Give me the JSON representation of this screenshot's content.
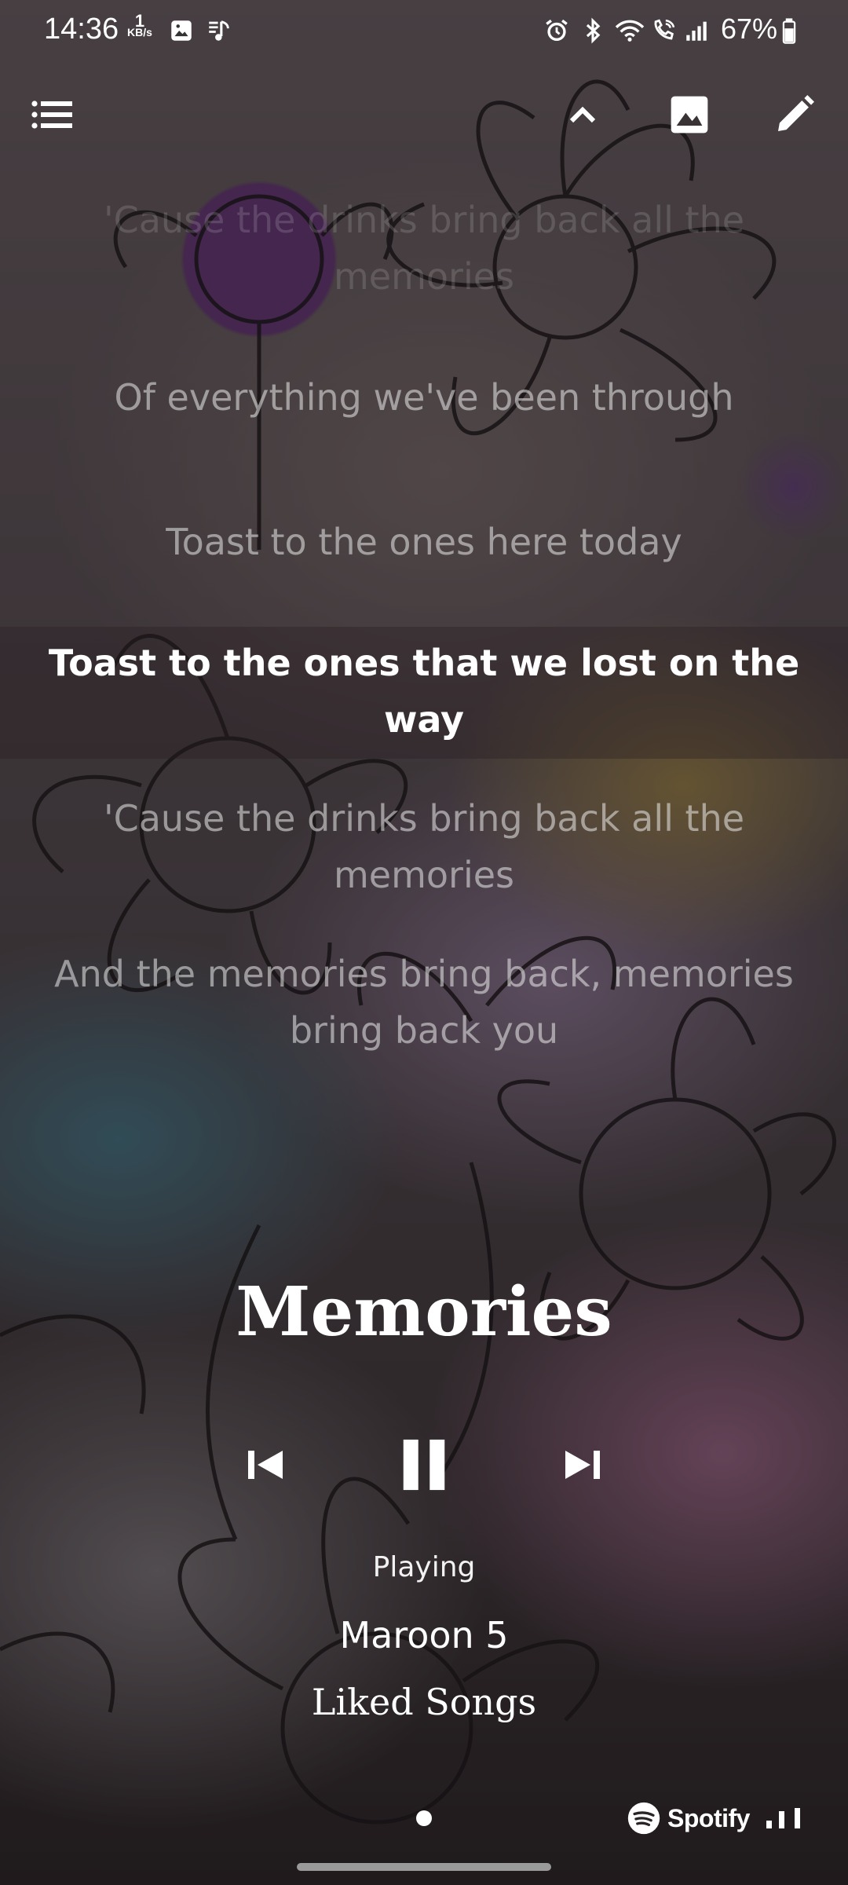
{
  "status_bar": {
    "time": "14:36",
    "net_speed_value": "1",
    "net_speed_unit": "KB/s",
    "battery": "67%",
    "icons": [
      "gallery-notification-icon",
      "music-notification-icon",
      "alarm-icon",
      "bluetooth-icon",
      "wifi-icon",
      "wifi-calling-icon",
      "signal-icon",
      "battery-icon"
    ]
  },
  "toolbar": {
    "icons": [
      "menu-icon",
      "chevron-up-icon",
      "image-icon",
      "edit-icon"
    ]
  },
  "lyrics": {
    "lines": [
      "'Cause the drinks bring back all the memories",
      "Of everything we've been through",
      "Toast to the ones here today",
      "Toast to the ones that we lost on the way",
      "'Cause the drinks bring back all the memories",
      "And the memories bring back, memories bring back you"
    ],
    "current_index": 3
  },
  "now_playing": {
    "title": "Memories",
    "status": "Playing",
    "artist": "Maroon 5",
    "source": "Liked Songs"
  },
  "controls": {
    "icons": [
      "skip-previous-icon",
      "pause-icon",
      "skip-next-icon"
    ]
  },
  "footer": {
    "brand": "Spotify",
    "page_indicator": "1 of 1"
  },
  "colors": {
    "text": "#ffffff",
    "lyric_inactive": "#ebebeb",
    "background_dark": "#1a1618"
  }
}
